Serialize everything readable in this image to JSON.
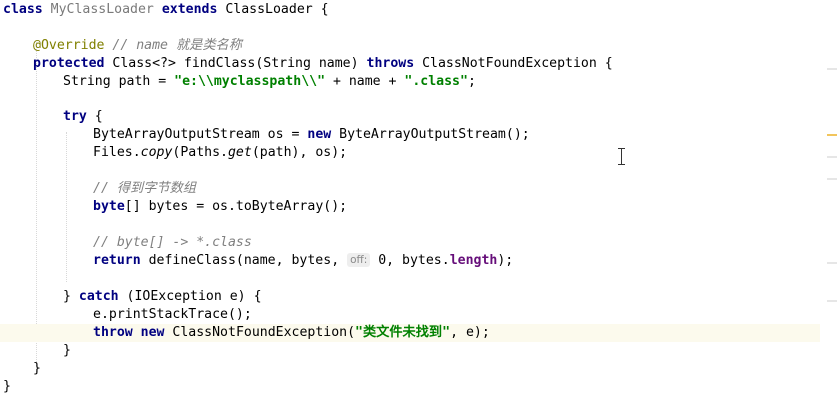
{
  "editor": {
    "lines": {
      "l1": {
        "kw_class": "class",
        "name": "MyClassLoader",
        "kw_extends": "extends",
        "parent": "ClassLoader {"
      },
      "l2": {
        "anno": "@Override",
        "comment": "// name 就是类名称"
      },
      "l3": {
        "kw_protected": "protected",
        "sig": "Class<?> findClass(String name)",
        "kw_throws": "throws",
        "exc": "ClassNotFoundException {"
      },
      "l4": {
        "pre": "String path = ",
        "str1": "\"e:\\\\myclasspath\\\\\"",
        "mid": " + name + ",
        "str2": "\".class\"",
        "end": ";"
      },
      "l5": {
        "kw_try": "try",
        "end": " {"
      },
      "l6": {
        "pre": "ByteArrayOutputStream os = ",
        "kw_new": "new",
        "end": " ByteArrayOutputStream();"
      },
      "l7": {
        "pre": "Files.",
        "m1": "copy",
        "mid": "(Paths.",
        "m2": "get",
        "end": "(path), os);"
      },
      "l8": {
        "comment": "// 得到字节数组"
      },
      "l9": {
        "kw_byte": "byte",
        "end": "[] bytes = os.toByteArray();"
      },
      "l10": {
        "comment": "// byte[] -> *.class"
      },
      "l11": {
        "kw_return": "return",
        "pre": " defineClass(name, bytes, ",
        "hint": "off:",
        "mid": " 0, bytes.",
        "field": "length",
        "end": ");"
      },
      "l12": {
        "pre": "} ",
        "kw_catch": "catch",
        "end": " (IOException e) {"
      },
      "l13": {
        "text": "e.printStackTrace();"
      },
      "l14": {
        "kw_throw": "throw",
        "kw_new": "new",
        "pre": " ClassNotFoundException(",
        "str": "\"类文件未找到\"",
        "end": ", e);"
      },
      "l15": {
        "text": "}"
      },
      "l16": {
        "text": "}"
      },
      "l17": {
        "text": "}"
      }
    }
  },
  "colors": {
    "keyword": "#000080",
    "string": "#008000",
    "comment": "#808080",
    "annotation": "#808000",
    "field": "#660e7a",
    "current_line": "#fcfaed",
    "scroll_marker_warning": "#f2c55c"
  }
}
